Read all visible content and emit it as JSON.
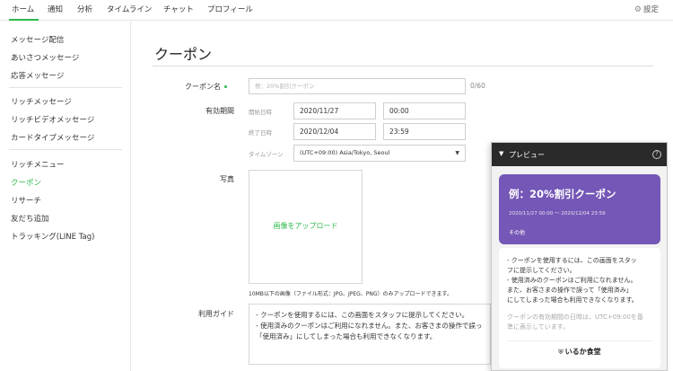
{
  "nav": {
    "tabs": [
      "ホーム",
      "通知",
      "分析",
      "タイムライン",
      "チャット",
      "プロフィール"
    ],
    "settings_label": "設定",
    "settings_icon": "gear-icon"
  },
  "sidebar": {
    "groups": [
      [
        "メッセージ配信",
        "あいさつメッセージ",
        "応答メッセージ"
      ],
      [
        "リッチメッセージ",
        "リッチビデオメッセージ",
        "カードタイプメッセージ"
      ],
      [
        "リッチメニュー",
        "クーポン",
        "リサーチ",
        "友だち追加",
        "トラッキング(LINE Tag)"
      ]
    ],
    "active": "クーポン"
  },
  "page": {
    "title": "クーポン"
  },
  "form": {
    "name_label": "クーポン名",
    "name_placeholder": "例：20%割引クーポン",
    "name_counter": "0/60",
    "period_label": "有効期間",
    "start_label": "開始日時",
    "start_date": "2020/11/27",
    "start_time": "00:00",
    "end_label": "終了日時",
    "end_date": "2020/12/04",
    "end_time": "23:59",
    "timezone_label": "タイムゾーン",
    "timezone_value": "(UTC+09:00) Asia/Tokyo, Seoul",
    "photo_label": "写真",
    "upload_label": "画像をアップロード",
    "upload_note": "10MB以下の画像（ファイル形式：JPG、JPEG、PNG）のみアップロードできます。",
    "guide_label": "利用ガイド",
    "guide_lines": [
      "- クーポンを使用するには、この画面をスタッフに提示してください。",
      "- 使用済みのクーポンはご利用になれません。また、お客さまの操作で誤っ",
      "「使用済み」にしてしまった場合も利用できなくなります。"
    ]
  },
  "preview": {
    "title": "プレビュー",
    "coupon_title": "例：20%割引クーポン",
    "coupon_dates": "2020/11/27 00:00 ～ 2020/12/04 23:59",
    "coupon_other": "その他",
    "coupon_color": "#7457b6",
    "details": [
      "- クーポンを使用するには、この画面をスタッ",
      "フに提示してください。",
      "- 使用済みのクーポンはご利用になれません。",
      "また、お客さまの操作で誤って「使用済み」",
      "にしてしまった場合も利用できなくなります。"
    ],
    "note_lines": [
      "クーポンの有効期間の日時は、UTC+09:00を基",
      "準に表示しています。"
    ],
    "shop_name": "いるか食堂"
  },
  "colors": {
    "accent": "#2bb84a",
    "preview_header": "#2a2a2a"
  }
}
